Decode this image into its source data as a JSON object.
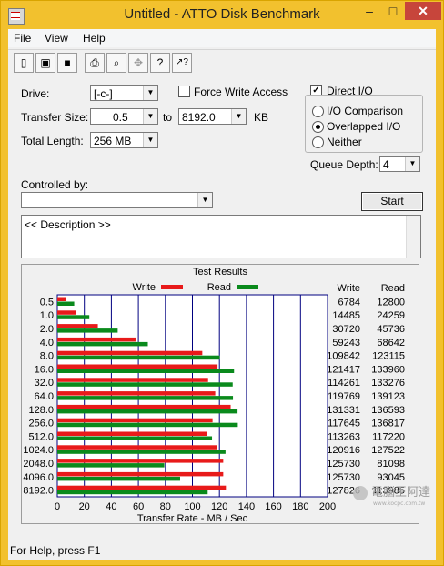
{
  "window": {
    "title": "Untitled - ATTO Disk Benchmark",
    "minimize": "–",
    "maximize": "□",
    "close": "✕"
  },
  "menu": [
    {
      "label": "File"
    },
    {
      "label": "View"
    },
    {
      "label": "Help"
    }
  ],
  "toolbar": {
    "icons": [
      "new-file-icon",
      "open-folder-icon",
      "save-icon",
      "print-icon",
      "print-preview-icon",
      "move-icon",
      "help-icon",
      "context-help-icon"
    ],
    "glyphs": [
      "▯",
      "▣",
      "■",
      "⎙",
      "⌕",
      "✥",
      "?",
      "↗?"
    ]
  },
  "settings": {
    "drive_label": "Drive:",
    "drive_value": "[-c-]",
    "transfer_size_label": "Transfer Size:",
    "transfer_from": "0.5",
    "to_label": "to",
    "transfer_to": "8192.0",
    "transfer_unit": "KB",
    "total_length_label": "Total Length:",
    "total_length_value": "256 MB",
    "force_write_label": "Force Write Access",
    "force_write_checked": false,
    "direct_io_label": "Direct I/O",
    "direct_io_checked": true,
    "io_comparison_label": "I/O Comparison",
    "overlapped_io_label": "Overlapped I/O",
    "neither_label": "Neither",
    "selected_io_mode": "Overlapped I/O",
    "queue_depth_label": "Queue Depth:",
    "queue_depth_value": "4",
    "controlled_by_label": "Controlled by:",
    "controlled_by_value": "",
    "start_label": "Start",
    "description_text": "<< Description >>"
  },
  "chart_data": {
    "type": "bar",
    "orientation": "horizontal",
    "title": "Test Results",
    "xlabel": "Transfer Rate - MB / Sec",
    "xlim": [
      0,
      200
    ],
    "xticks": [
      0,
      20,
      40,
      60,
      80,
      100,
      120,
      140,
      160,
      180,
      200
    ],
    "categories": [
      "0.5",
      "1.0",
      "2.0",
      "4.0",
      "8.0",
      "16.0",
      "32.0",
      "64.0",
      "128.0",
      "256.0",
      "512.0",
      "1024.0",
      "2048.0",
      "4096.0",
      "8192.0"
    ],
    "series": [
      {
        "name": "Write",
        "color": "#e81a1a",
        "values": [
          6.6,
          14.1,
          30.0,
          57.9,
          107.3,
          118.6,
          111.6,
          116.9,
          128.3,
          114.9,
          110.6,
          118.1,
          122.8,
          122.8,
          124.8
        ]
      },
      {
        "name": "Read",
        "color": "#0a8a1c",
        "values": [
          12.5,
          23.7,
          44.7,
          67.0,
          120.2,
          130.8,
          129.8,
          130.0,
          133.4,
          133.6,
          114.5,
          124.5,
          79.2,
          90.9,
          111.3
        ]
      }
    ],
    "table": {
      "write_header": "Write",
      "read_header": "Read",
      "write": [
        "6784",
        "14485",
        "30720",
        "59243",
        "109842",
        "121417",
        "114261",
        "119769",
        "131331",
        "117645",
        "113263",
        "120916",
        "125730",
        "125730",
        "127826"
      ],
      "read": [
        "12800",
        "24259",
        "45736",
        "68642",
        "123115",
        "133960",
        "133276",
        "139123",
        "136593",
        "136817",
        "117220",
        "127522",
        "81098",
        "93045",
        "113985"
      ]
    },
    "grid": true,
    "legend": "top"
  },
  "status": {
    "text": "For Help, press F1"
  },
  "watermark": {
    "name": "電腦王阿達",
    "url": "www.kocpc.com.tw"
  }
}
